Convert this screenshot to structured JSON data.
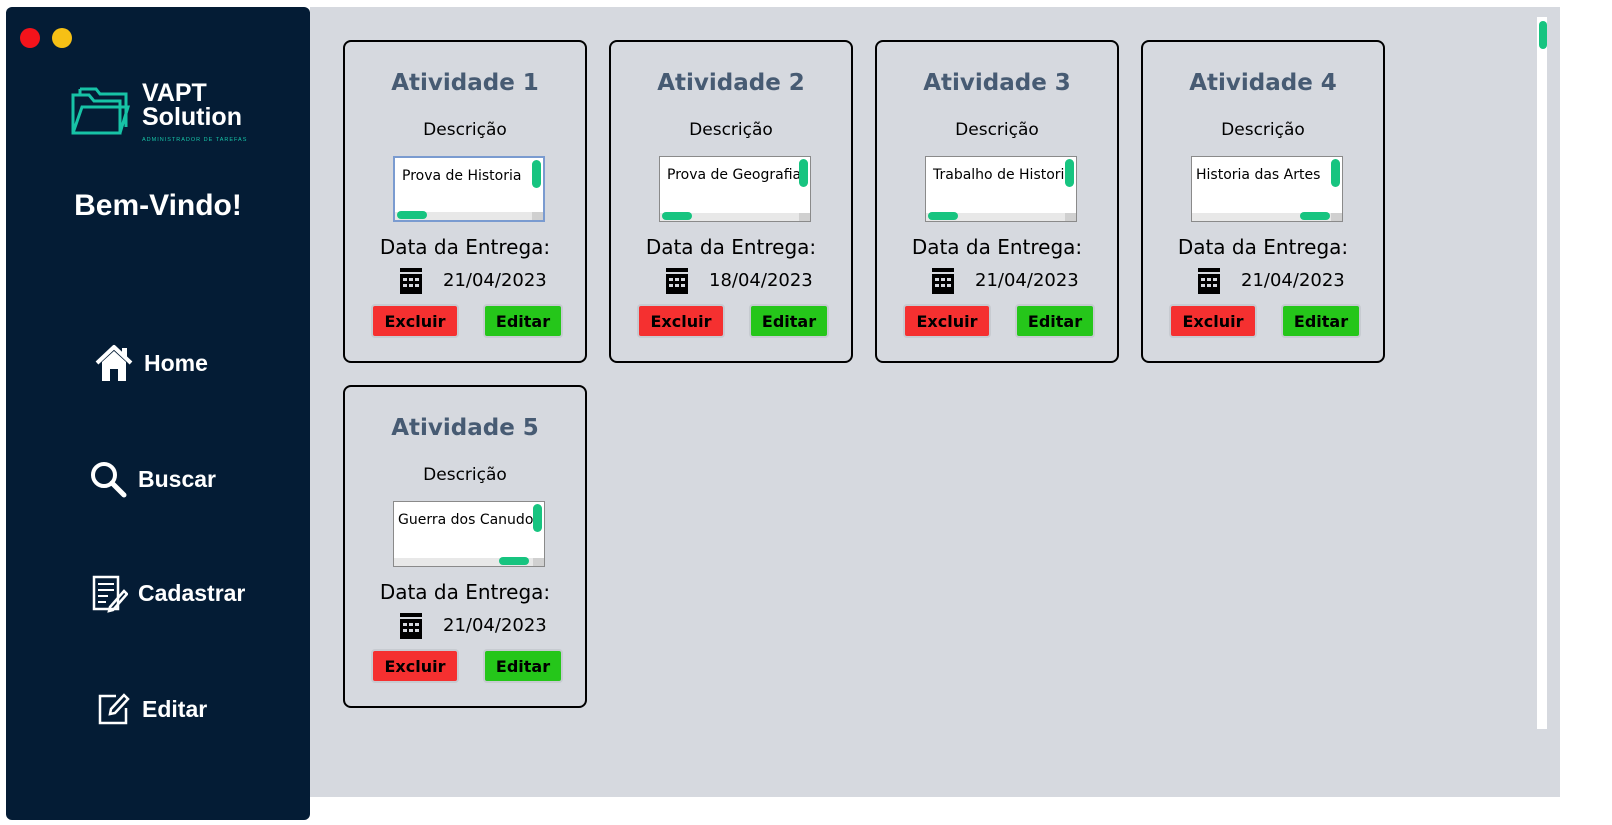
{
  "window": {
    "controls": [
      "close",
      "minimize"
    ]
  },
  "sidebar": {
    "logo": {
      "line1": "VAPT",
      "line2": "Solution",
      "tagline": "ADMINISTRADOR DE TAREFAS",
      "icon": "folder-icon"
    },
    "welcome": "Bem-Vindo!",
    "items": [
      {
        "label": "Home",
        "icon": "home-icon"
      },
      {
        "label": "Buscar",
        "icon": "search-icon"
      },
      {
        "label": "Cadastrar",
        "icon": "register-form-icon"
      },
      {
        "label": "Editar",
        "icon": "edit-icon"
      }
    ]
  },
  "colors": {
    "sidebar_bg": "#041c35",
    "main_bg": "#d6d9df",
    "accent": "#17c480",
    "card_title": "#475b73",
    "delete": "#f53030",
    "edit": "#25c61a"
  },
  "activities": [
    {
      "title": "Atividade 1",
      "desc_label": "Descrição",
      "description": "Prova de Historia",
      "date_label": "Data da Entrega:",
      "date": "21/04/2023",
      "delete_label": "Excluir",
      "edit_label": "Editar"
    },
    {
      "title": "Atividade 2",
      "desc_label": "Descrição",
      "description": "Prova de Geografia",
      "date_label": "Data da Entrega:",
      "date": "18/04/2023",
      "delete_label": "Excluir",
      "edit_label": "Editar"
    },
    {
      "title": "Atividade 3",
      "desc_label": "Descrição",
      "description": "Trabalho de Historia",
      "date_label": "Data da Entrega:",
      "date": "21/04/2023",
      "delete_label": "Excluir",
      "edit_label": "Editar"
    },
    {
      "title": "Atividade 4",
      "desc_label": "Descrição",
      "description": "Historia das Artes",
      "date_label": "Data da Entrega:",
      "date": "21/04/2023",
      "delete_label": "Excluir",
      "edit_label": "Editar"
    },
    {
      "title": "Atividade 5",
      "desc_label": "Descrição",
      "description": "Guerra dos Canudos",
      "date_label": "Data da Entrega:",
      "date": "21/04/2023",
      "delete_label": "Excluir",
      "edit_label": "Editar"
    }
  ]
}
